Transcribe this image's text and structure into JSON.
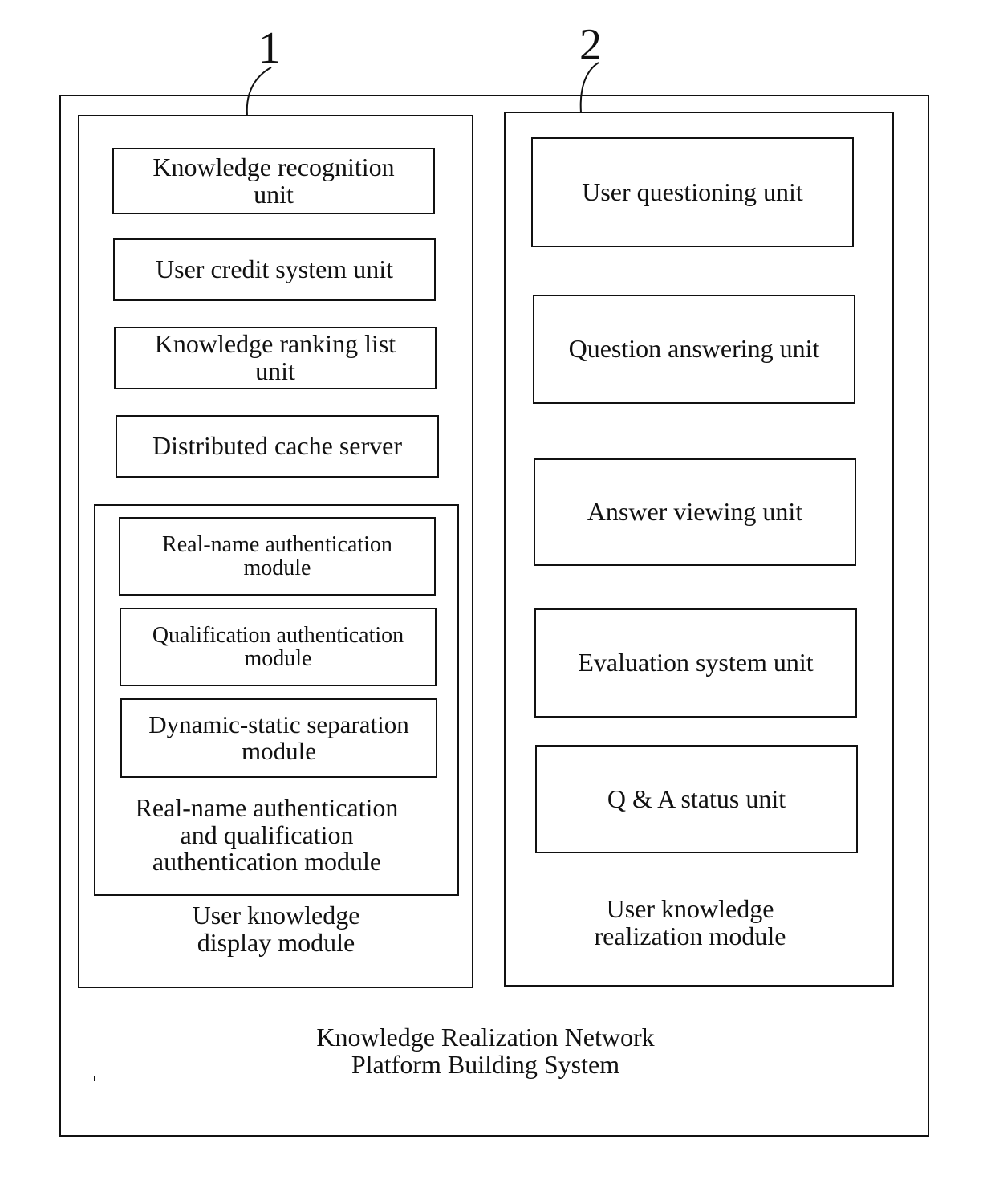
{
  "diagram": {
    "system_title": "Knowledge Realization Network\nPlatform Building System",
    "reference_numerals": [
      "1",
      "2"
    ],
    "left_module": {
      "title": "User knowledge\ndisplay module",
      "units": [
        "Knowledge recognition\nunit",
        "User credit system unit",
        "Knowledge ranking list\nunit",
        "Distributed cache server"
      ],
      "auth_group": {
        "title": "Real-name authentication\nand qualification\nauthentication module",
        "modules": [
          "Real-name authentication\nmodule",
          "Qualification authentication\nmodule",
          "Dynamic-static separation\nmodule"
        ]
      }
    },
    "right_module": {
      "title": "User knowledge\nrealization module",
      "units": [
        "User questioning unit",
        "Question answering unit",
        "Answer viewing unit",
        "Evaluation system unit",
        "Q & A status unit"
      ]
    }
  }
}
